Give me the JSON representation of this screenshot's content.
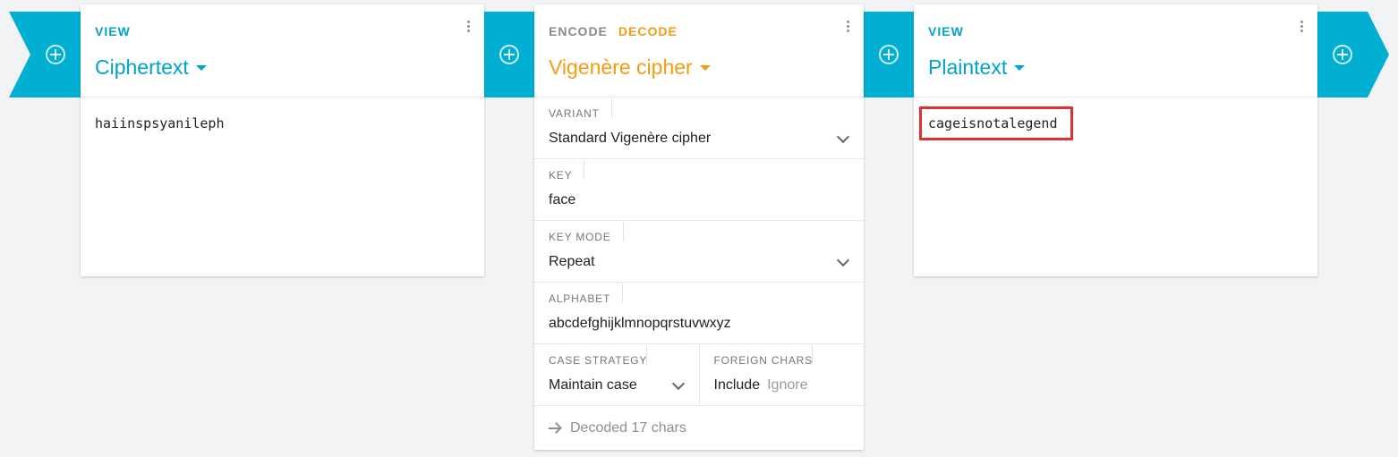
{
  "colors": {
    "accent": "#00afd1",
    "decode": "#f39c12",
    "highlight": "#e03030",
    "background": "#f2f3f5"
  },
  "connectors": [
    {
      "icon": "add-circle-icon"
    },
    {
      "icon": "add-circle-icon"
    },
    {
      "icon": "add-circle-icon"
    },
    {
      "icon": "add-circle-icon"
    }
  ],
  "cards": {
    "ciphertext": {
      "tab": "VIEW",
      "title": "Ciphertext",
      "content": "haiinspsyanileph"
    },
    "cipher": {
      "tabs": {
        "encode": "ENCODE",
        "decode": "DECODE"
      },
      "title": "Vigenère cipher",
      "settings": {
        "variant": {
          "label": "VARIANT",
          "value": "Standard Vigenère cipher"
        },
        "key": {
          "label": "KEY",
          "value": "face"
        },
        "key_mode": {
          "label": "KEY MODE",
          "value": "Repeat"
        },
        "alphabet": {
          "label": "ALPHABET",
          "value": "abcdefghijklmnopqrstuvwxyz"
        },
        "case_strategy": {
          "label": "CASE STRATEGY",
          "value": "Maintain case"
        },
        "foreign_chars": {
          "label": "FOREIGN CHARS",
          "include": "Include",
          "ignore": "Ignore"
        }
      },
      "footer": "Decoded 17 chars"
    },
    "plaintext": {
      "tab": "VIEW",
      "title": "Plaintext",
      "content": "cageisnotalegend"
    }
  }
}
